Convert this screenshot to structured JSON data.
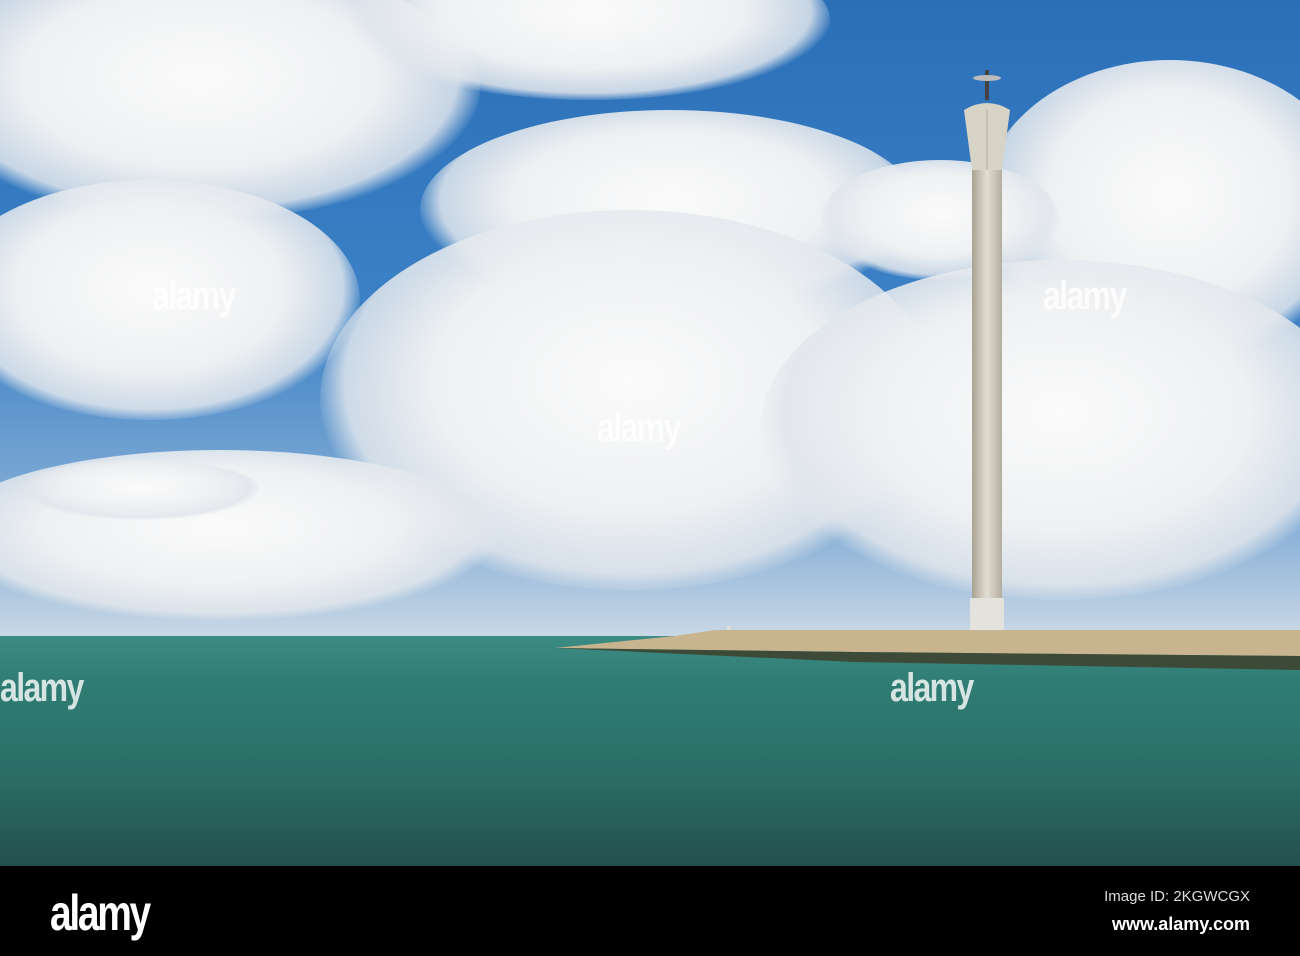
{
  "watermark": "alamy",
  "footer": {
    "logo": "alamy",
    "image_id": "Image ID: 2KGWCGX",
    "website": "www.alamy.com"
  },
  "colors": {
    "sky": "#3d82c6",
    "sea": "#2f7d74",
    "footer": "#000000"
  }
}
